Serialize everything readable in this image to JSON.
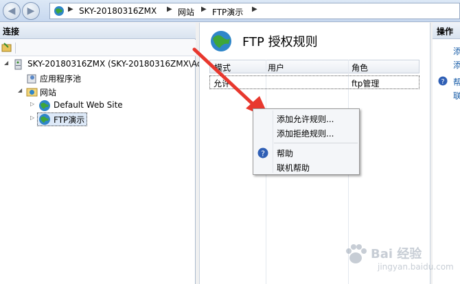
{
  "breadcrumb": {
    "items": [
      "SKY-20180316ZMX",
      "网站",
      "FTP演示"
    ]
  },
  "left_panel": {
    "header": "连接",
    "tree": [
      {
        "label": "SKY-20180316ZMX (SKY-20180316ZMX\\Ad"
      },
      {
        "label": "应用程序池"
      },
      {
        "label": "网站"
      },
      {
        "label": "Default Web Site"
      },
      {
        "label": "FTP演示"
      }
    ]
  },
  "center_panel": {
    "title": "FTP 授权规则",
    "columns": [
      "模式",
      "用户",
      "角色"
    ],
    "rows": [
      {
        "mode": "允许",
        "user": "",
        "role": "ftp管理"
      }
    ]
  },
  "right_panel": {
    "header": "操作",
    "items": [
      "添",
      "添",
      "帮",
      "联"
    ]
  },
  "context_menu": {
    "items": [
      "添加允许规则...",
      "添加拒绝规则...",
      "帮助",
      "联机帮助"
    ]
  },
  "watermark": {
    "text": "Bai 经验",
    "sub": "jingyan.baidu.com"
  },
  "colors": {
    "accent": "#e8382e",
    "link": "#1a5ea8"
  }
}
